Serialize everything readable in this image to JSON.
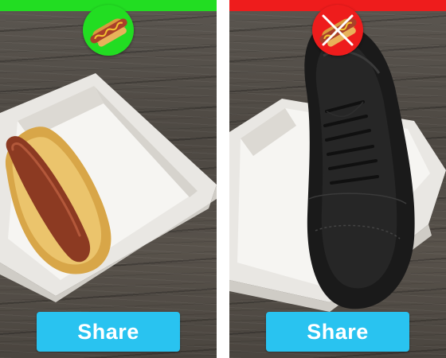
{
  "left_panel": {
    "status": "approved",
    "accent": "#22dd22",
    "badge_icon": "hotdog-icon",
    "photo": "hotdog-in-paper-tray",
    "share_label": "Share"
  },
  "right_panel": {
    "status": "rejected",
    "accent": "#ee1c1c",
    "badge_icon": "crossed-out-hotdog-icon",
    "photo": "shoe-in-paper-tray",
    "share_label": "Share"
  },
  "colors": {
    "share_button": "#29c3f0",
    "share_text": "#ffffff",
    "wood": "#524d47"
  }
}
